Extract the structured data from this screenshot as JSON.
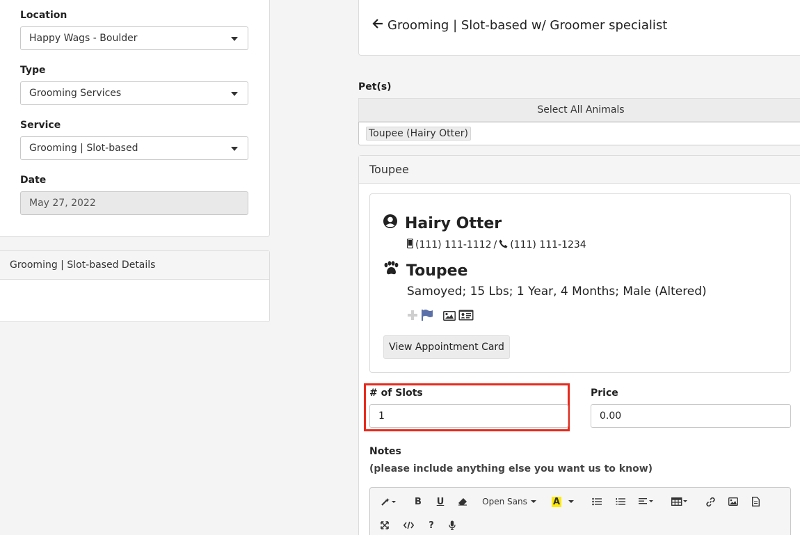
{
  "filters": {
    "location": {
      "label": "Location",
      "value": "Happy Wags - Boulder"
    },
    "type": {
      "label": "Type",
      "value": "Grooming Services"
    },
    "service": {
      "label": "Service",
      "value": "Grooming | Slot-based"
    },
    "date": {
      "label": "Date",
      "value": "May 27, 2022"
    }
  },
  "details_panel": {
    "title": "Grooming | Slot-based Details"
  },
  "header": {
    "back_icon": "arrow-left-icon",
    "title": "Grooming | Slot-based w/ Groomer specialist"
  },
  "pets": {
    "label": "Pet(s)",
    "select_all": "Select All Animals",
    "selected_tag": "Toupee (Hairy Otter)"
  },
  "pet_card": {
    "header": "Toupee",
    "owner_name": "Hairy Otter",
    "mobile_phone": "(111) 111-1112",
    "separator": "/",
    "home_phone": "(111) 111-1234",
    "pet_name": "Toupee",
    "pet_description": "Samoyed; 15 Lbs; 1 Year, 4 Months; Male (Altered)",
    "view_card_button": "View Appointment Card",
    "icons": [
      "user-circle-icon",
      "mobile-phone-icon",
      "phone-icon",
      "paw-icon",
      "plus-icon",
      "flag-icon",
      "image-icon",
      "id-card-icon"
    ]
  },
  "slots": {
    "label": "# of Slots",
    "value": "1"
  },
  "price": {
    "label": "Price",
    "value": "0.00"
  },
  "notes": {
    "label": "Notes",
    "subtitle": "(please include anything else you want us to know)"
  },
  "editor_toolbar": {
    "font_name": "Open Sans",
    "buttons": [
      "magic-icon",
      "bold-icon",
      "underline-icon",
      "eraser-icon",
      "font-name-dropdown",
      "text-color-icon",
      "unordered-list-icon",
      "ordered-list-icon",
      "align-icon",
      "table-icon",
      "link-icon",
      "picture-icon",
      "file-icon",
      "fullscreen-icon",
      "code-view-icon",
      "help-icon",
      "microphone-icon"
    ]
  },
  "colors": {
    "highlight": "#e8291c",
    "flag": "#5b6fa8",
    "text_color_bg": "#ffea00"
  }
}
